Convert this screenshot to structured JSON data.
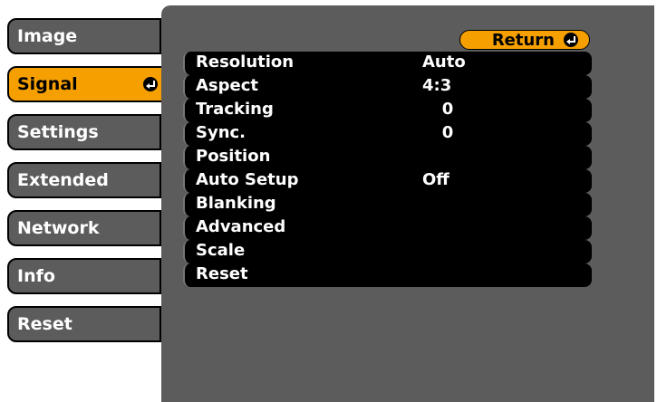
{
  "sidebar": {
    "items": [
      {
        "label": "Image",
        "selected": false
      },
      {
        "label": "Signal",
        "selected": true
      },
      {
        "label": "Settings",
        "selected": false
      },
      {
        "label": "Extended",
        "selected": false
      },
      {
        "label": "Network",
        "selected": false
      },
      {
        "label": "Info",
        "selected": false
      },
      {
        "label": "Reset",
        "selected": false
      }
    ]
  },
  "main": {
    "return_label": "Return",
    "settings": [
      {
        "label": "Resolution",
        "value": "Auto"
      },
      {
        "label": "Aspect",
        "value": "4:3"
      },
      {
        "label": "Tracking",
        "value": "0"
      },
      {
        "label": "Sync.",
        "value": "0"
      },
      {
        "label": "Position",
        "value": ""
      },
      {
        "label": "Auto Setup",
        "value": "Off"
      },
      {
        "label": "Blanking",
        "value": ""
      },
      {
        "label": "Advanced",
        "value": ""
      },
      {
        "label": "Scale",
        "value": ""
      },
      {
        "label": "Reset",
        "value": ""
      }
    ]
  },
  "colors": {
    "panel": "#5c5c5c",
    "highlight": "#f5a000",
    "row": "#000000",
    "text": "#ffffff"
  },
  "icons": {
    "enter": "enter-icon"
  }
}
